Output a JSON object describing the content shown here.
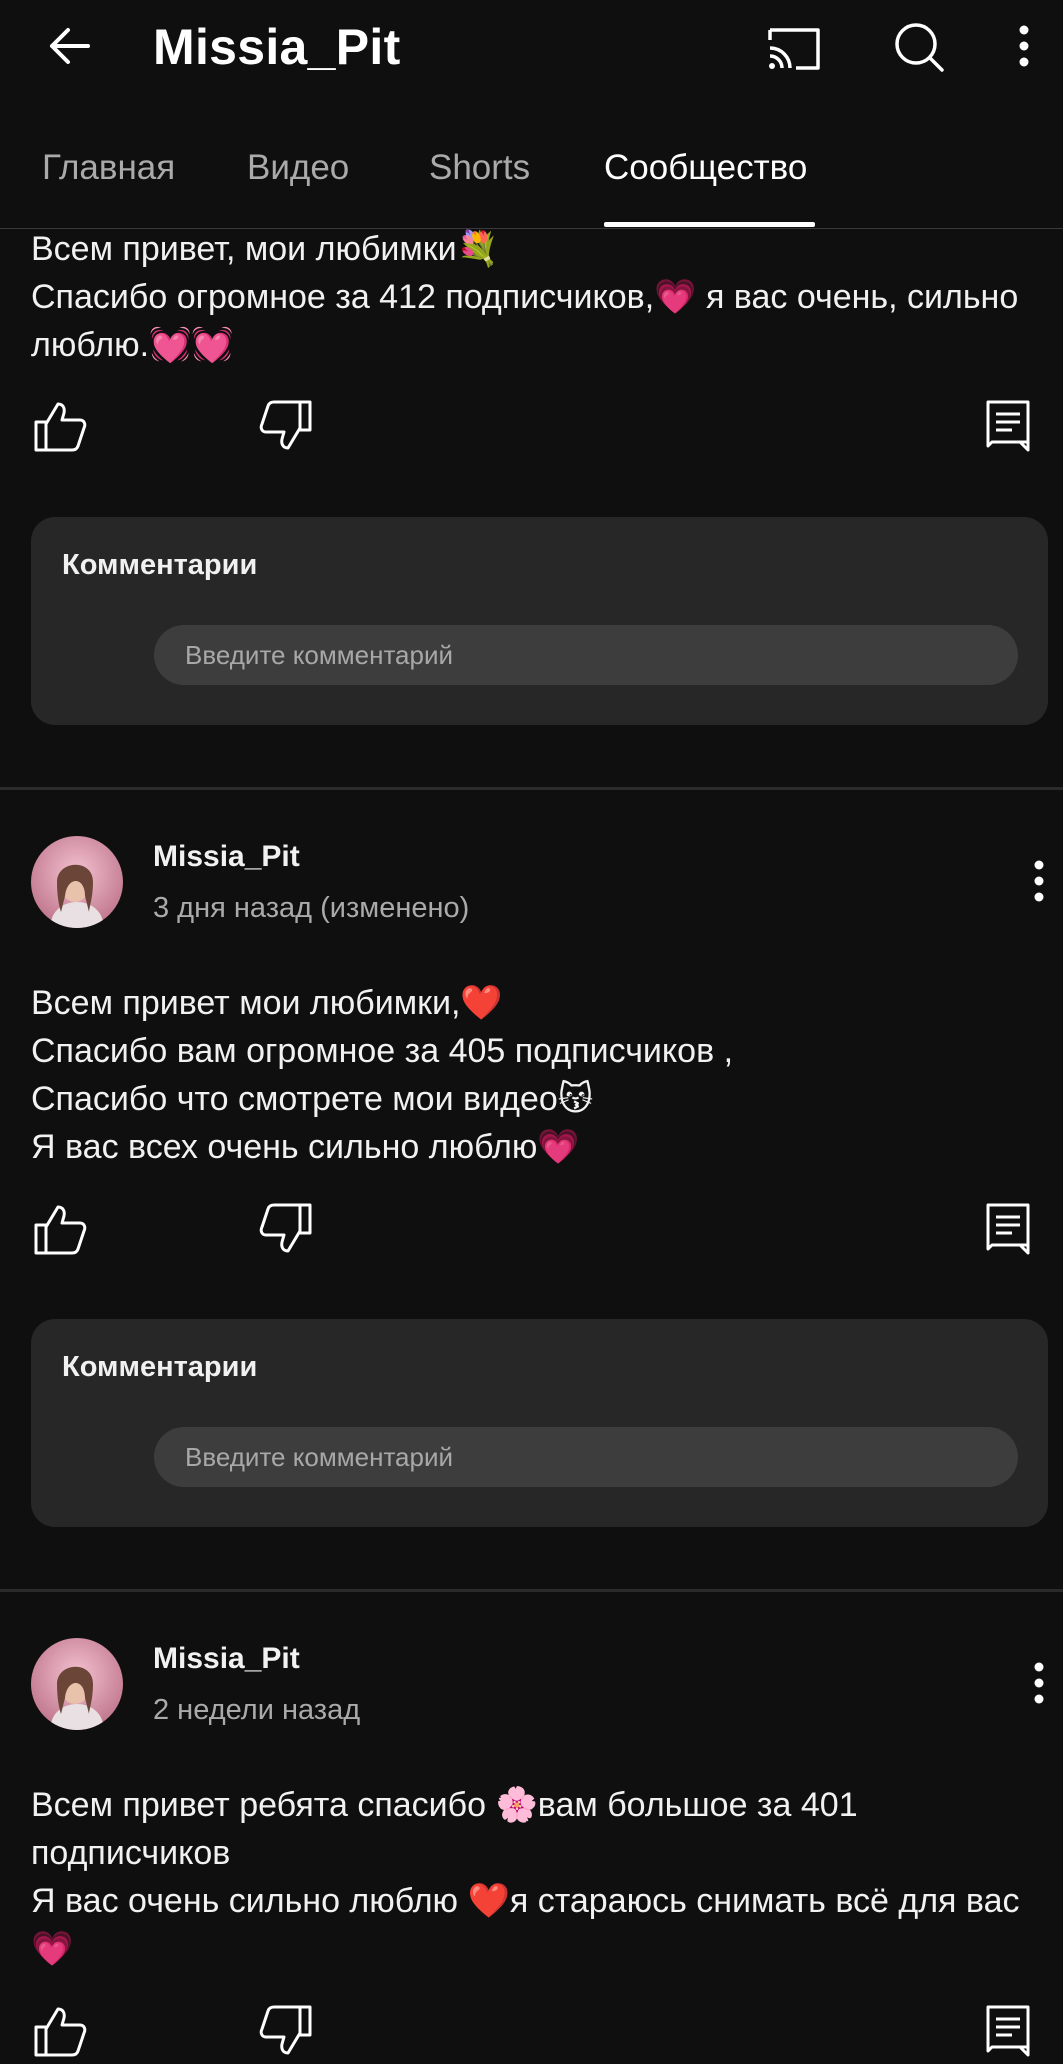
{
  "header": {
    "title": "Missia_Pit"
  },
  "tabs": [
    {
      "label": "Главная"
    },
    {
      "label": "Видео"
    },
    {
      "label": "Shorts"
    },
    {
      "label": "Сообщество",
      "active": true
    }
  ],
  "posts": [
    {
      "text": "Всем привет, мои любимки💐\nСпасибо огромное за 412 подписчиков,💗 я вас  очень, сильно люблю.💓💓",
      "comments_label": "Комментарии",
      "comment_placeholder": "Введите комментарий"
    },
    {
      "author": "Missia_Pit",
      "time": "3 дня назад (изменено)",
      "text": "Всем привет мои любимки,❤️\nСпасибо вам огромное за 405 подписчиков ,\nСпасибо что смотрете мои видео😽\nЯ вас всех очень сильно люблю💗",
      "comments_label": "Комментарии",
      "comment_placeholder": "Введите комментарий"
    },
    {
      "author": "Missia_Pit",
      "time": "2 недели назад",
      "text": "Всем привет ребята спасибо 🌸вам большое за 401 подписчиков\nЯ вас очень сильно люблю ❤️я стараюсь снимать всё для вас💗"
    }
  ],
  "icons": {
    "back": "arrow-left-icon",
    "cast": "cast-icon",
    "search": "search-icon",
    "more": "more-vertical-icon",
    "like": "thumbs-up-icon",
    "dislike": "thumbs-down-icon",
    "comment": "comment-icon"
  },
  "colors": {
    "background": "#0f0f0f",
    "card": "#272727",
    "input": "#3d3d3d",
    "secondary_text": "#aaaaaa"
  }
}
